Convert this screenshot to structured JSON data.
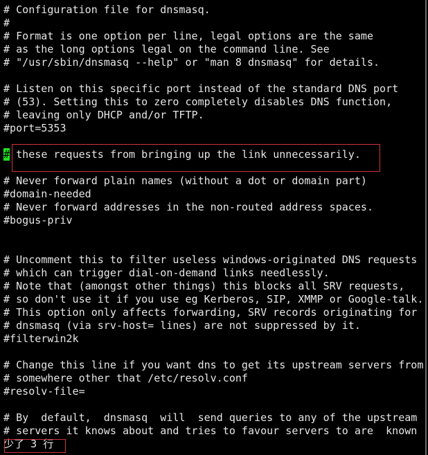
{
  "editor": {
    "lines": [
      "# Configuration file for dnsmasq.",
      "#",
      "# Format is one option per line, legal options are the same",
      "# as the long options legal on the command line. See",
      "# \"/usr/sbin/dnsmasq --help\" or \"man 8 dnsmasq\" for details.",
      "",
      "# Listen on this specific port instead of the standard DNS port",
      "# (53). Setting this to zero completely disables DNS function,",
      "# leaving only DHCP and/or TFTP.",
      "#port=5353",
      "",
      "",
      "",
      "# Never forward plain names (without a dot or domain part)",
      "#domain-needed",
      "# Never forward addresses in the non-routed address spaces.",
      "#bogus-priv",
      "",
      "",
      "# Uncomment this to filter useless windows-originated DNS requests",
      "# which can trigger dial-on-demand links needlessly.",
      "# Note that (amongst other things) this blocks all SRV requests,",
      "# so don't use it if you use eg Kerberos, SIP, XMMP or Google-talk.",
      "# This option only affects forwarding, SRV records originating for",
      "# dnsmasq (via srv-host= lines) are not suppressed by it.",
      "#filterwin2k",
      "",
      "# Change this line if you want dns to get its upstream servers from",
      "# somewhere other that /etc/resolv.conf",
      "#resolv-file=",
      "",
      "# By  default,  dnsmasq  will  send queries to any of the upstream",
      "# servers it knows about and tries to favour servers to are  known"
    ],
    "cursor_line": {
      "cursor_char": "#",
      "text": " these requests from bringing up the link unnecessarily."
    },
    "status_message": "少了 3 行",
    "colors": {
      "cursor": "#22e022",
      "highlight_box": "#d0343c",
      "text": "#e6e6e6",
      "background": "#000000"
    }
  }
}
